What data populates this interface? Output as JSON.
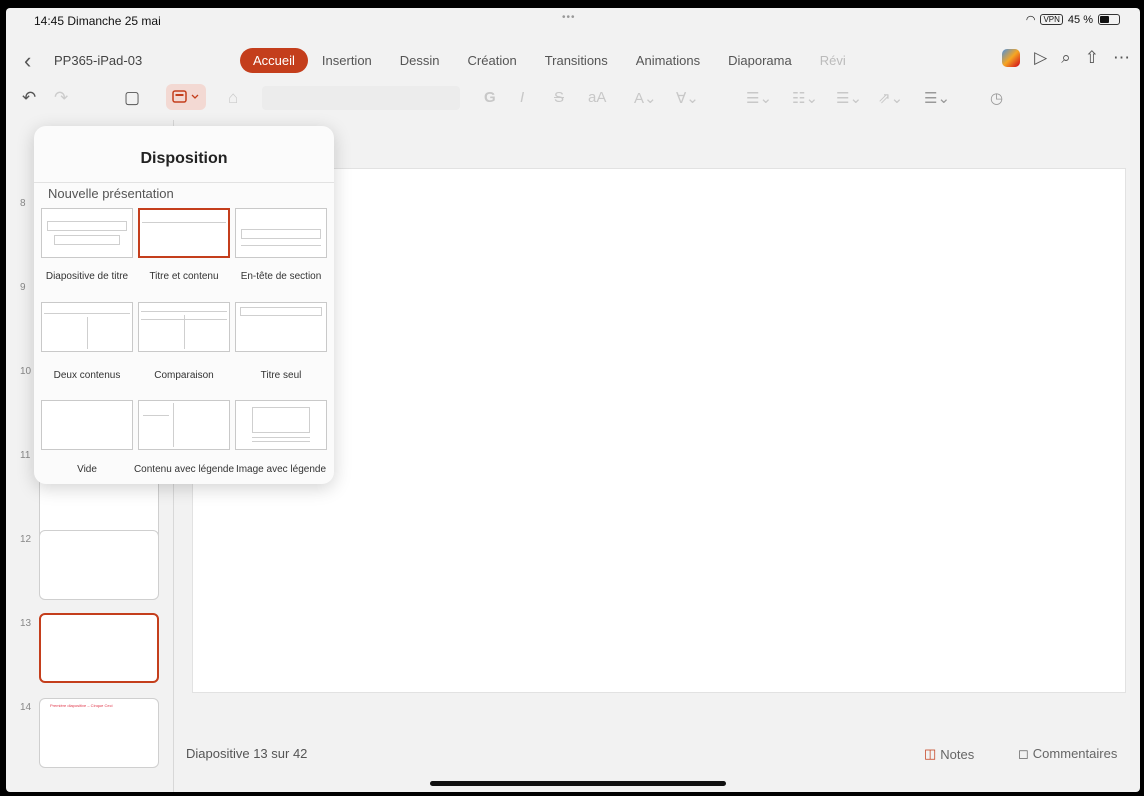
{
  "status": {
    "time": "14:45  Dimanche 25 mai",
    "dots": "•••",
    "vpn": "VPN",
    "battery": "45 %"
  },
  "header": {
    "doc_name": "PP365-iPad-03",
    "tabs": [
      "Accueil",
      "Insertion",
      "Dessin",
      "Création",
      "Transitions",
      "Animations",
      "Diaporama",
      "Révi"
    ],
    "active_tab": "Accueil"
  },
  "toolbar": {
    "bold": "G",
    "italic": "I",
    "strike": "S",
    "fontsize": "aA"
  },
  "thumbs": [
    {
      "num": "8"
    },
    {
      "num": "9"
    },
    {
      "num": "10"
    },
    {
      "num": "11"
    },
    {
      "num": "12"
    },
    {
      "num": "13"
    },
    {
      "num": "14",
      "text": "Première diapositive – Cinque Ceci"
    }
  ],
  "popover": {
    "title": "Disposition",
    "section": "Nouvelle présentation",
    "layouts": [
      "Diapositive de titre",
      "Titre et contenu",
      "En-tête de section",
      "Deux contenus",
      "Comparaison",
      "Titre seul",
      "Vide",
      "Contenu avec légende",
      "Image avec légende"
    ]
  },
  "footer": {
    "slide_info": "Diapositive 13 sur 42",
    "notes": "Notes",
    "comments": "Commentaires"
  }
}
